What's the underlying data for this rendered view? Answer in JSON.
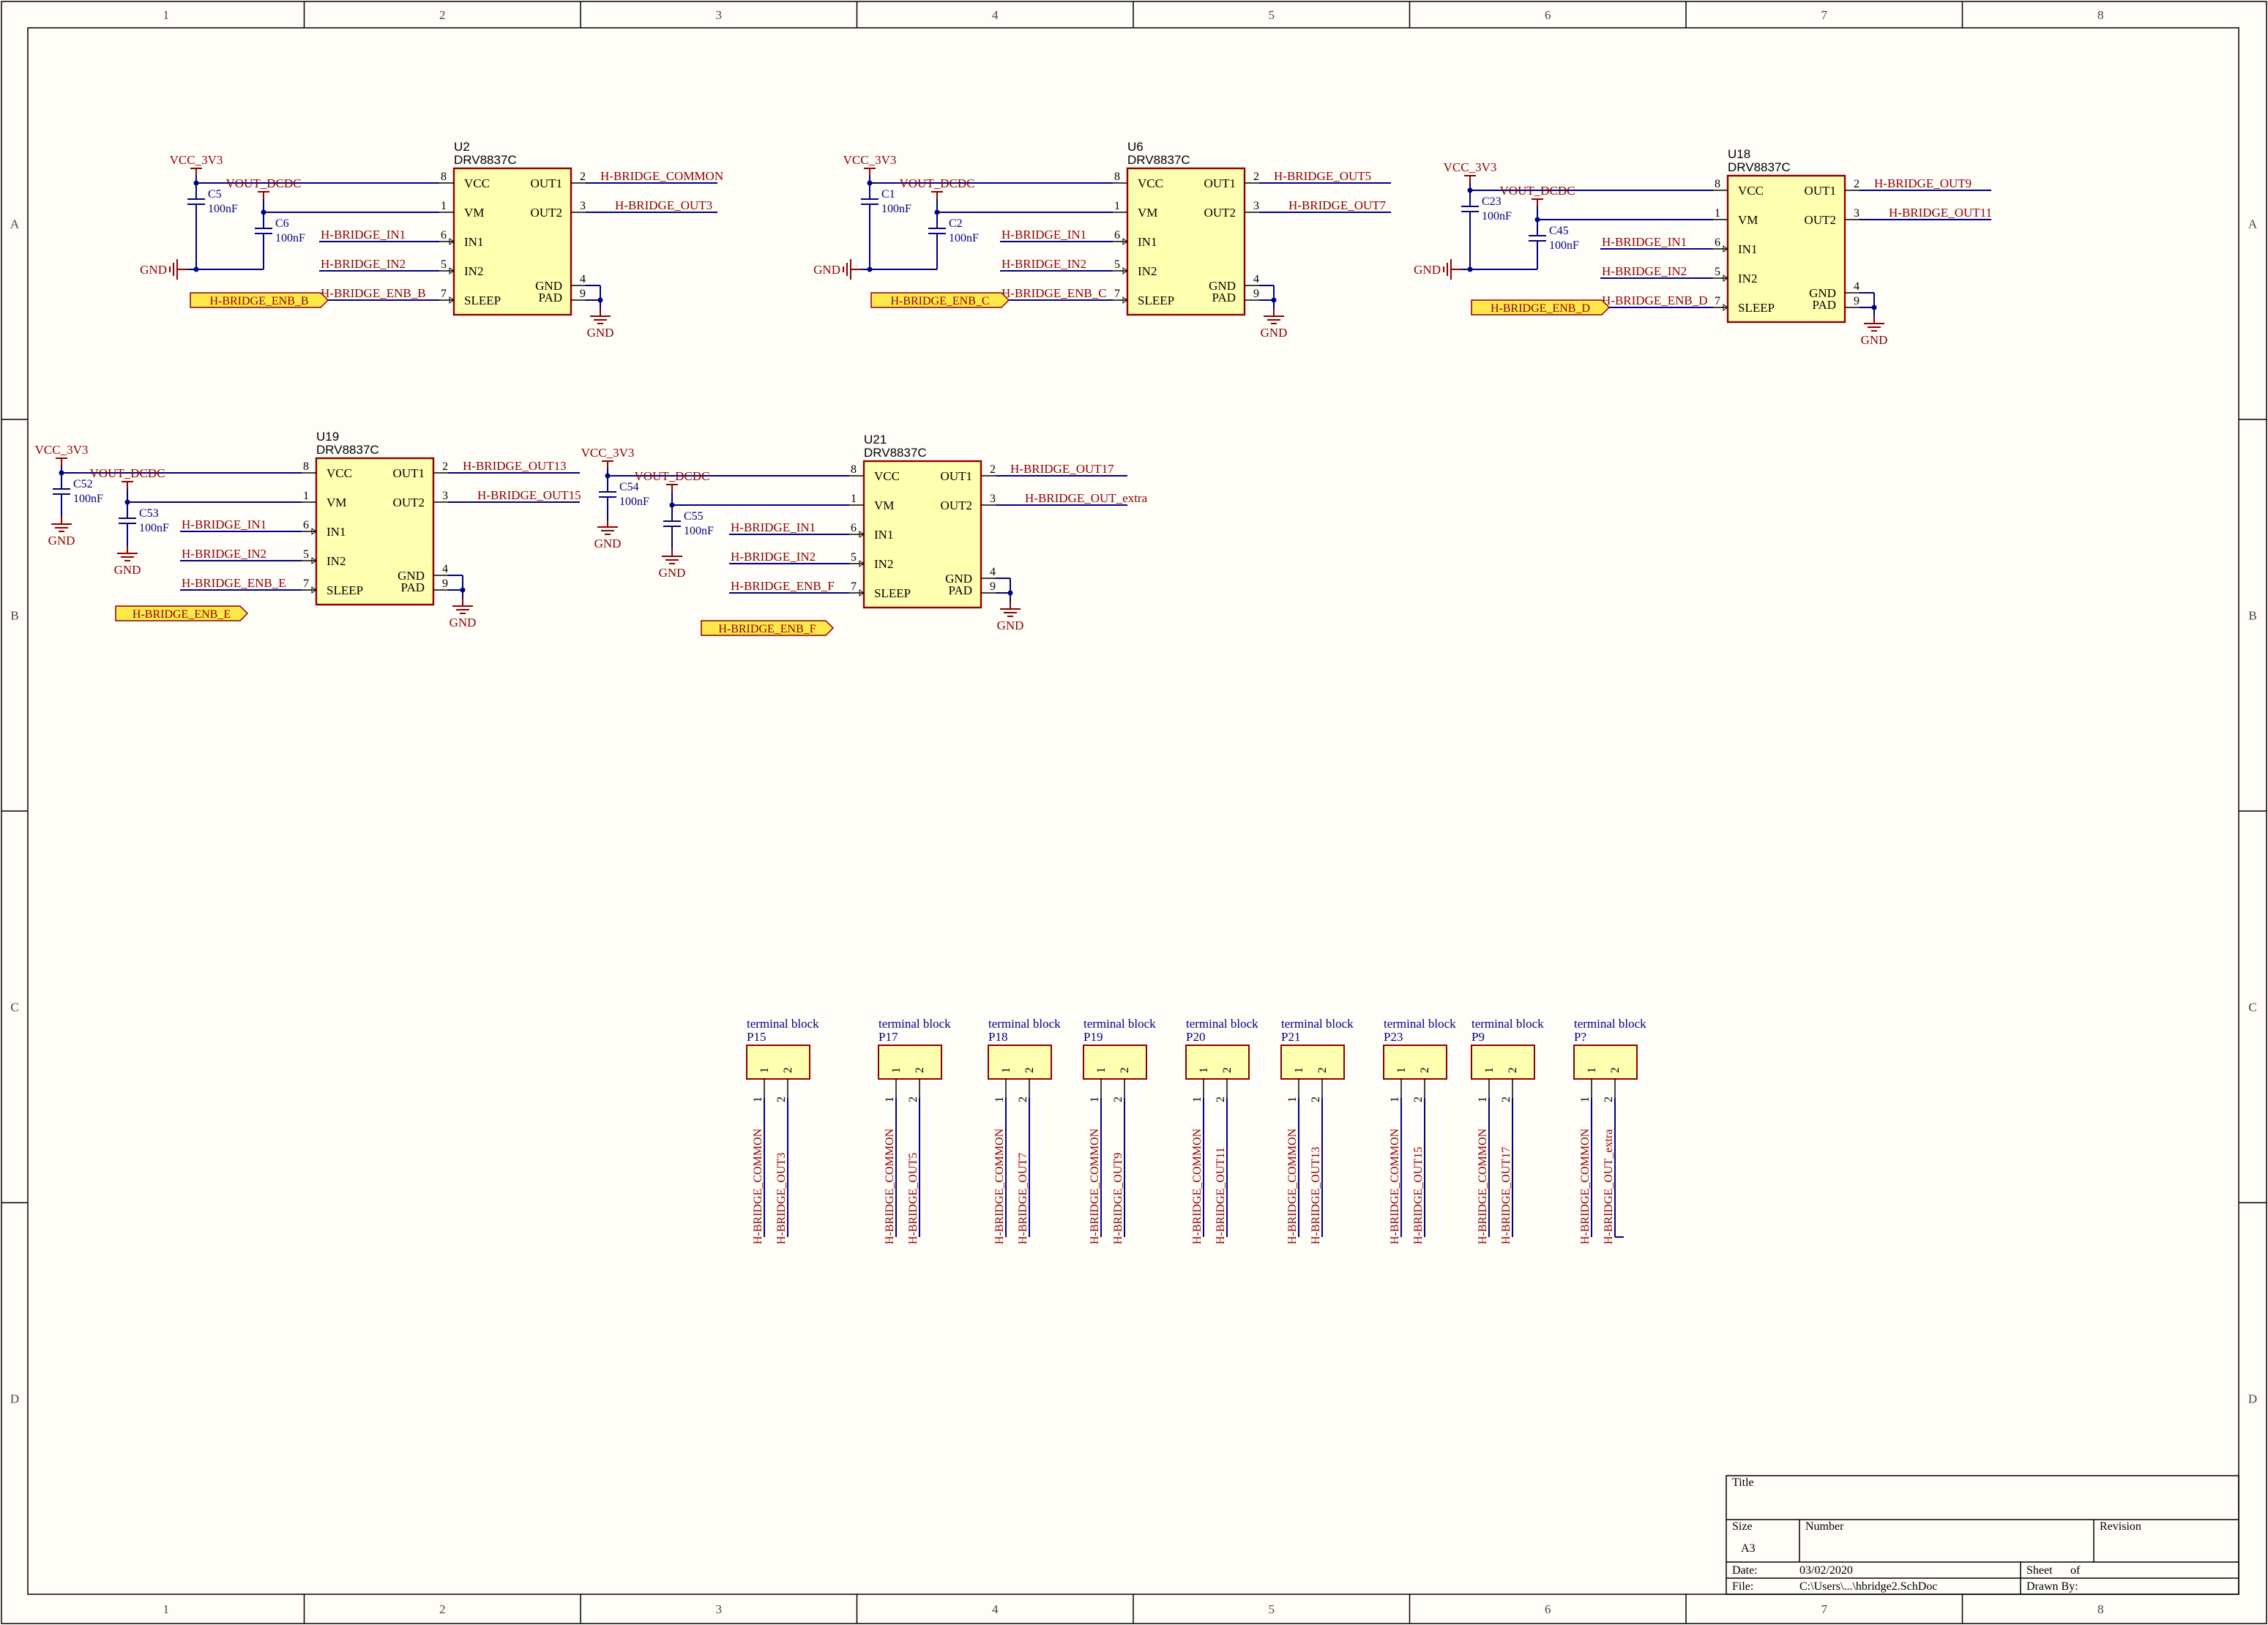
{
  "zones": {
    "columns": [
      "1",
      "2",
      "3",
      "4",
      "5",
      "6",
      "7",
      "8"
    ],
    "rows": [
      "A",
      "B",
      "C",
      "D"
    ]
  },
  "drivers": [
    {
      "ref": "U2",
      "part": "DRV8837C",
      "vcc": "VCC_3V3",
      "vm": "VOUT_DCDC",
      "c1": {
        "ref": "C5",
        "value": "100nF"
      },
      "c2": {
        "ref": "C6",
        "value": "100nF"
      },
      "in1": "H-BRIDGE_IN1",
      "in2": "H-BRIDGE_IN2",
      "enb": "H-BRIDGE_ENB_B",
      "port": "H-BRIDGE_ENB_B",
      "out1": "H-BRIDGE_COMMON",
      "out2": "H-BRIDGE_OUT3",
      "gnd": "GND",
      "gndleft": "GND"
    },
    {
      "ref": "U6",
      "part": "DRV8837C",
      "vcc": "VCC_3V3",
      "vm": "VOUT_DCDC",
      "c1": {
        "ref": "C1",
        "value": "100nF"
      },
      "c2": {
        "ref": "C2",
        "value": "100nF"
      },
      "in1": "H-BRIDGE_IN1",
      "in2": "H-BRIDGE_IN2",
      "enb": "H-BRIDGE_ENB_C",
      "port": "H-BRIDGE_ENB_C",
      "out1": "H-BRIDGE_OUT5",
      "out2": "H-BRIDGE_OUT7",
      "gnd": "GND",
      "gndleft": "GND"
    },
    {
      "ref": "U18",
      "part": "DRV8837C",
      "vcc": "VCC_3V3",
      "vm": "VOUT_DCDC",
      "c1": {
        "ref": "C23",
        "value": "100nF"
      },
      "c2": {
        "ref": "C45",
        "value": "100nF"
      },
      "in1": "H-BRIDGE_IN1",
      "in2": "H-BRIDGE_IN2",
      "enb": "H-BRIDGE_ENB_D",
      "port": "H-BRIDGE_ENB_D",
      "out1": "H-BRIDGE_OUT9",
      "out2": "H-BRIDGE_OUT11",
      "gnd": "GND",
      "gndleft": "GND"
    },
    {
      "ref": "U19",
      "part": "DRV8837C",
      "vcc": "VCC_3V3",
      "vm": "VOUT_DCDC",
      "c1": {
        "ref": "C52",
        "value": "100nF"
      },
      "c2": {
        "ref": "C53",
        "value": "100nF"
      },
      "in1": "H-BRIDGE_IN1",
      "in2": "H-BRIDGE_IN2",
      "enb": "H-BRIDGE_ENB_E",
      "port": "H-BRIDGE_ENB_E",
      "out1": "H-BRIDGE_OUT13",
      "out2": "H-BRIDGE_OUT15",
      "gnd": "GND",
      "gndc1": "GND",
      "gndc2": "GND"
    },
    {
      "ref": "U21",
      "part": "DRV8837C",
      "vcc": "VCC_3V3",
      "vm": "VOUT_DCDC",
      "c1": {
        "ref": "C54",
        "value": "100nF"
      },
      "c2": {
        "ref": "C55",
        "value": "100nF"
      },
      "in1": "H-BRIDGE_IN1",
      "in2": "H-BRIDGE_IN2",
      "enb": "H-BRIDGE_ENB_F",
      "port": "H-BRIDGE_ENB_F",
      "out1": "H-BRIDGE_OUT17",
      "out2": "H-BRIDGE_OUT_extra",
      "gnd": "GND",
      "gndc1": "GND",
      "gndc2": "GND"
    }
  ],
  "pins": {
    "vcc": "VCC",
    "vm": "VM",
    "in1": "IN1",
    "in2": "IN2",
    "sleep": "SLEEP",
    "out1": "OUT1",
    "out2": "OUT2",
    "gnd": "GND",
    "pad": "PAD",
    "n_vcc": "8",
    "n_vm": "1",
    "n_in1": "6",
    "n_in2": "5",
    "n_sleep": "7",
    "n_out1": "2",
    "n_out2": "3",
    "n_gnd": "4",
    "n_pad": "9"
  },
  "terminals": [
    {
      "title": "terminal block",
      "ref": "P15",
      "net1": "H-BRIDGE_COMMON",
      "net2": "H-BRIDGE_OUT3"
    },
    {
      "title": "terminal block",
      "ref": "P17",
      "net1": "H-BRIDGE_COMMON",
      "net2": "H-BRIDGE_OUT5"
    },
    {
      "title": "terminal block",
      "ref": "P18",
      "net1": "H-BRIDGE_COMMON",
      "net2": "H-BRIDGE_OUT7"
    },
    {
      "title": "terminal block",
      "ref": "P19",
      "net1": "H-BRIDGE_COMMON",
      "net2": "H-BRIDGE_OUT9"
    },
    {
      "title": "terminal block",
      "ref": "P20",
      "net1": "H-BRIDGE_COMMON",
      "net2": "H-BRIDGE_OUT11"
    },
    {
      "title": "terminal block",
      "ref": "P21",
      "net1": "H-BRIDGE_COMMON",
      "net2": "H-BRIDGE_OUT13"
    },
    {
      "title": "terminal block",
      "ref": "P23",
      "net1": "H-BRIDGE_COMMON",
      "net2": "H-BRIDGE_OUT15"
    },
    {
      "title": "terminal block",
      "ref": "P9",
      "net1": "H-BRIDGE_COMMON",
      "net2": "H-BRIDGE_OUT17"
    },
    {
      "title": "terminal block",
      "ref": "P?",
      "net1": "H-BRIDGE_COMMON",
      "net2": "H-BRIDGE_OUT_extra"
    }
  ],
  "terminal_pins": {
    "p1": "1",
    "p2": "2"
  },
  "titleblock": {
    "title_label": "Title",
    "size_label": "Size",
    "size_value": "A3",
    "number_label": "Number",
    "revision_label": "Revision",
    "date_label": "Date:",
    "date_value": "03/02/2020",
    "sheet_label": "Sheet",
    "of_label": "of",
    "file_label": "File:",
    "file_value": "C:\\Users\\...\\hbridge2.SchDoc",
    "drawn_label": "Drawn By:"
  }
}
